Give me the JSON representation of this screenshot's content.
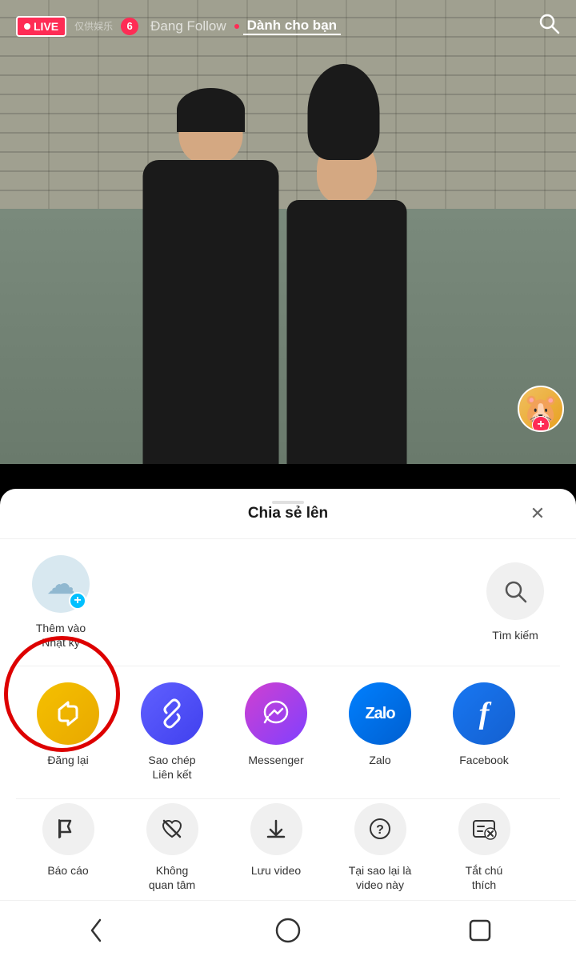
{
  "nav": {
    "live_label": "LIVE",
    "watermark": "仅供娱乐",
    "notification_count": "6",
    "tab_following": "Đang Follow",
    "tab_foryou": "Dành cho bạn",
    "tab_dot_visible": true
  },
  "sheet": {
    "title": "Chia sẻ lên",
    "close_label": "✕",
    "top_items": [
      {
        "id": "add-diary",
        "icon": "☁",
        "label": "Thêm vào\nNhật ký",
        "has_plus": true
      },
      {
        "id": "search",
        "icon": "🔍",
        "label": "Tìm kiếm",
        "has_plus": false
      }
    ],
    "apps": [
      {
        "id": "repost",
        "label": "Đăng lại",
        "icon_text": "↺"
      },
      {
        "id": "copy-link",
        "label": "Sao chép\nLiên kết",
        "icon_text": "🔗"
      },
      {
        "id": "messenger",
        "label": "Messenger",
        "icon_text": "✉"
      },
      {
        "id": "zalo",
        "label": "Zalo",
        "icon_text": "Zalo"
      },
      {
        "id": "facebook",
        "label": "Facebook",
        "icon_text": "f"
      }
    ],
    "actions": [
      {
        "id": "report",
        "label": "Báo cáo",
        "icon": "🚩"
      },
      {
        "id": "not-interested",
        "label": "Không\nquan tâm",
        "icon": "💔"
      },
      {
        "id": "save-video",
        "label": "Lưu video",
        "icon": "⬇"
      },
      {
        "id": "why-this",
        "label": "Tại sao lại là\nvideo này",
        "icon": "?"
      },
      {
        "id": "turn-off-captions",
        "label": "Tắt chú\nthích",
        "icon": "⊠"
      }
    ]
  },
  "bottom_nav": {
    "back": "‹",
    "home": "○",
    "recent": "□"
  }
}
